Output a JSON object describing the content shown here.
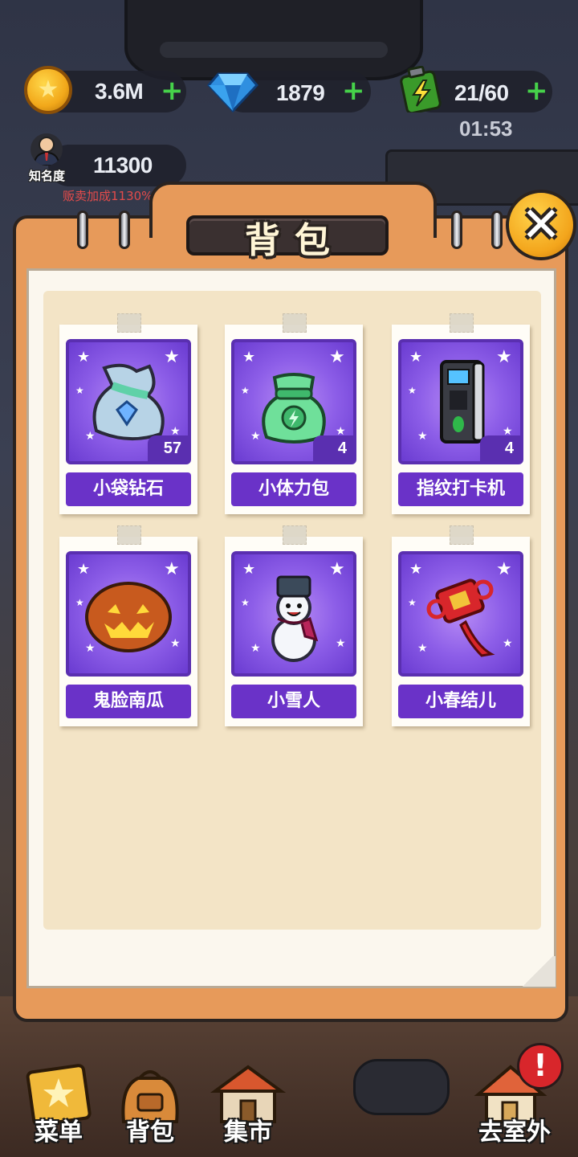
{
  "resources": {
    "coins": {
      "value": "3.6M",
      "plus": "+"
    },
    "gems": {
      "value": "1879",
      "plus": "+"
    },
    "energy": {
      "value": "21/60",
      "plus": "+",
      "timer": "01:53"
    },
    "fame": {
      "label": "知名度",
      "value": "11300",
      "bonus": "贩卖加成1130%"
    }
  },
  "panel": {
    "title": "背包",
    "close_label": "✕"
  },
  "items": [
    {
      "name": "小袋钻石",
      "count": "57",
      "icon": "diamond-bag-icon"
    },
    {
      "name": "小体力包",
      "count": "4",
      "icon": "energy-bag-icon"
    },
    {
      "name": "指纹打卡机",
      "count": "4",
      "icon": "fingerprint-clock-icon"
    },
    {
      "name": "鬼脸南瓜",
      "count": "",
      "icon": "jack-o-lantern-icon"
    },
    {
      "name": "小雪人",
      "count": "",
      "icon": "snowman-icon"
    },
    {
      "name": "小春结儿",
      "count": "",
      "icon": "chinese-knot-icon"
    }
  ],
  "nav": {
    "menu": "菜单",
    "bag": "背包",
    "market": "集市",
    "outdoor": "去室外",
    "alert": "!"
  },
  "colors": {
    "panel_orange": "#e79a5a",
    "slot_purple": "#8d5ee8",
    "name_bar_purple": "#6a32c8",
    "plus_green": "#46d34a",
    "close_gold": "#f3a51c"
  }
}
